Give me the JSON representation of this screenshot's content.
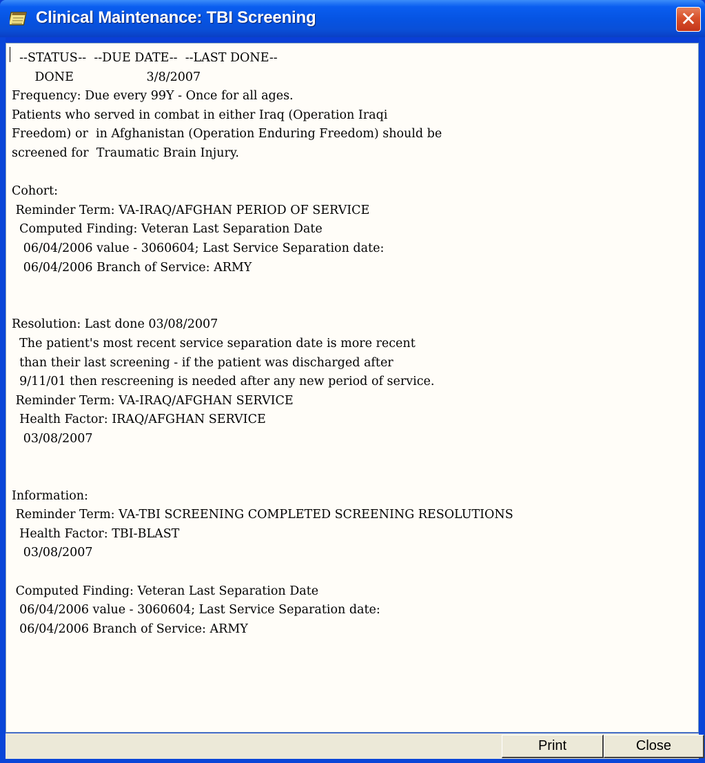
{
  "window": {
    "title": "Clinical Maintenance: TBI Screening",
    "title_icon": "notepad-icon",
    "close_icon": "close-x-icon",
    "close_glyph": "✕",
    "accent_color": "#0a5ef0"
  },
  "report": {
    "lines": [
      "  --STATUS--  --DUE DATE--  --LAST DONE--",
      "      DONE                   3/8/2007",
      "Frequency: Due every 99Y - Once for all ages.",
      "Patients who served in combat in either Iraq (Operation Iraqi",
      "Freedom) or  in Afghanistan (Operation Enduring Freedom) should be",
      "screened for  Traumatic Brain Injury.",
      "",
      "Cohort:",
      " Reminder Term: VA-IRAQ/AFGHAN PERIOD OF SERVICE",
      "  Computed Finding: Veteran Last Separation Date",
      "   06/04/2006 value - 3060604; Last Service Separation date:",
      "   06/04/2006 Branch of Service: ARMY",
      "",
      "",
      "Resolution: Last done 03/08/2007",
      "  The patient's most recent service separation date is more recent",
      "  than their last screening - if the patient was discharged after",
      "  9/11/01 then rescreening is needed after any new period of service.",
      " Reminder Term: VA-IRAQ/AFGHAN SERVICE",
      "  Health Factor: IRAQ/AFGHAN SERVICE",
      "   03/08/2007",
      "",
      "",
      "Information:",
      " Reminder Term: VA-TBI SCREENING COMPLETED SCREENING RESOLUTIONS",
      "  Health Factor: TBI-BLAST",
      "   03/08/2007",
      "",
      " Computed Finding: Veteran Last Separation Date",
      "  06/04/2006 value - 3060604; Last Service Separation date:",
      "  06/04/2006 Branch of Service: ARMY"
    ]
  },
  "buttons": {
    "print_label": "Print",
    "close_label": "Close"
  }
}
